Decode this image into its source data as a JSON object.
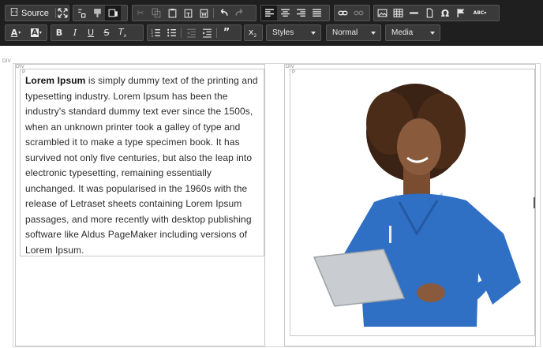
{
  "toolbar": {
    "row1": {
      "source_label": "Source",
      "groups": [
        {
          "name": "document",
          "items": [
            "source-icon",
            "maximize-icon"
          ]
        },
        {
          "name": "blocks",
          "items": [
            "show-blocks-icon",
            "templates-icon",
            "preview-icon"
          ]
        },
        {
          "name": "clipboard",
          "items": [
            "cut-icon",
            "copy-icon",
            "paste-icon",
            "paste-text-icon",
            "paste-word-icon",
            "undo-icon",
            "redo-icon"
          ]
        },
        {
          "name": "align",
          "items": [
            "align-left-icon",
            "align-center-icon",
            "align-right-icon",
            "justify-icon"
          ]
        },
        {
          "name": "links",
          "items": [
            "link-icon",
            "unlink-icon"
          ]
        },
        {
          "name": "insert",
          "items": [
            "image-icon",
            "table-icon",
            "horizontal-line-icon",
            "page-break-icon",
            "special-char-icon",
            "anchor-flag-icon",
            "spellcheck-icon"
          ]
        }
      ]
    },
    "row2": {
      "styles_label": "Styles",
      "format_label": "Normal",
      "media_label": "Media",
      "groups": [
        {
          "name": "colors",
          "items": [
            "text-color-icon",
            "background-color-icon"
          ]
        },
        {
          "name": "basic",
          "items": [
            "bold-icon",
            "italic-icon",
            "underline-icon",
            "strikethrough-icon",
            "remove-format-icon"
          ]
        },
        {
          "name": "lists",
          "items": [
            "numbered-list-icon",
            "bulleted-list-icon",
            "outdent-icon",
            "indent-icon",
            "blockquote-icon"
          ]
        },
        {
          "name": "script",
          "items": [
            "subscript-icon"
          ]
        }
      ]
    }
  },
  "editor": {
    "tags": {
      "outer_div": "DIV",
      "left_div": "DIV",
      "left_p": "P",
      "right_div": "DIV",
      "right_p": "P"
    },
    "paragraph": {
      "bold_lead": "Lorem Ipsum",
      "body": " is simply dummy text of the printing and typesetting industry. Lorem Ipsum has been the industry's standard dummy text ever since the 1500s, when an unknown printer took a galley of type and scrambled it to make a type specimen book. It has survived not only five centuries, but also the leap into electronic typesetting, remaining essentially unchanged. It was popularised in the 1960s with the release of Letraset sheets containing Lorem Ipsum passages, and more recently with desktop publishing software like Aldus PageMaker including versions of Lorem Ipsum."
    },
    "image": {
      "subject": "nurse-with-tablet",
      "colors": {
        "scrubs": "#2f6fc4",
        "skin": "#8a5a3c",
        "hair": "#3a2214",
        "tablet": "#c9ccd1"
      }
    }
  },
  "colors": {
    "toolbar_bg": "#1f1f1f",
    "button_bg": "#3a3a3a",
    "block_outline": "#c8c8c8",
    "text": "#2b2b2b"
  }
}
